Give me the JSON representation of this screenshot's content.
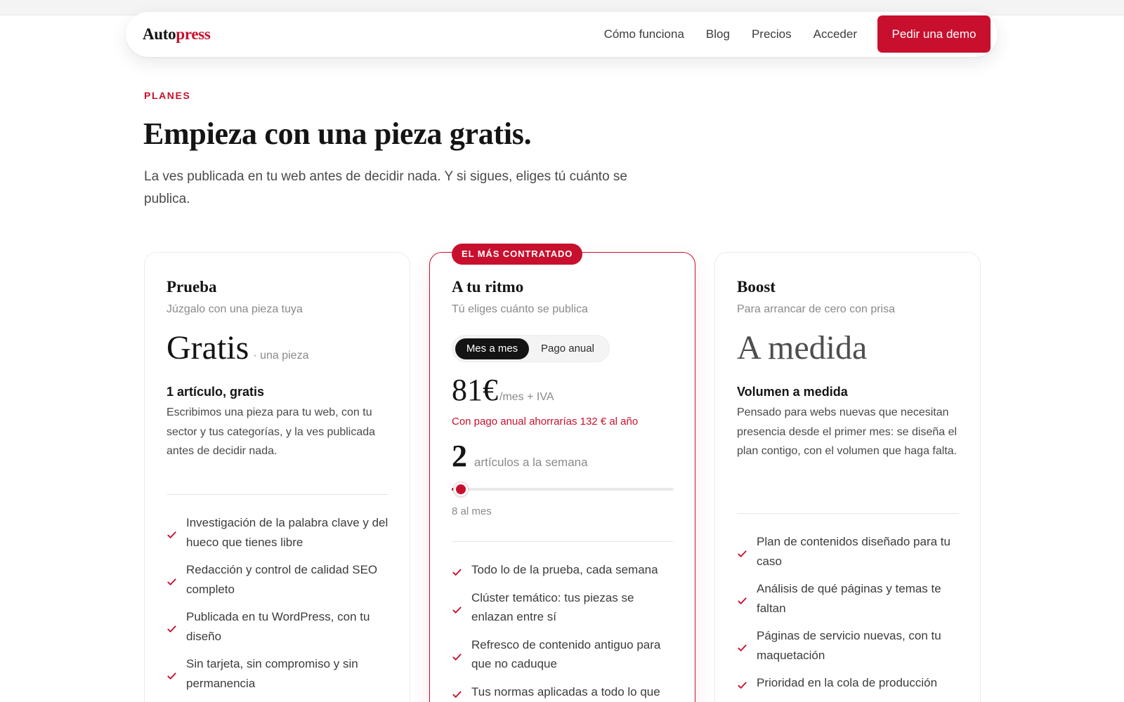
{
  "nav": {
    "logo_main": "Auto",
    "logo_accent": "press",
    "links": [
      "Cómo funciona",
      "Blog",
      "Precios",
      "Acceder"
    ],
    "cta": "Pedir una demo"
  },
  "hero": {
    "eyebrow": "PLANES",
    "title": "Empieza con una pieza gratis.",
    "subtitle": "La ves publicada en tu web antes de decidir nada. Y si sigues, eliges tú cuánto se publica."
  },
  "plans": [
    {
      "name": "Prueba",
      "tagline": "Júzgalo con una pieza tuya",
      "price": "Gratis",
      "price_suffix": "· una pieza",
      "feature_title": "1 artículo, gratis",
      "feature_desc": "Escribimos una pieza para tu web, con tu sector y tus categorías, y la ves publicada antes de decidir nada.",
      "features": [
        "Investigación de la palabra clave y del hueco que tienes libre",
        "Redacción y control de calidad SEO completo",
        "Publicada en tu WordPress, con tu diseño",
        "Sin tarjeta, sin compromiso y sin permanencia"
      ]
    },
    {
      "badge": "EL MÁS CONTRATADO",
      "name": "A tu ritmo",
      "tagline": "Tú eliges cuánto se publica",
      "billing_options": [
        "Mes a mes",
        "Pago anual"
      ],
      "billing_selected": "Mes a mes",
      "price": "81€",
      "price_suffix": "/mes + IVA",
      "saving_note": "Con pago anual ahorrarías 132 € al año",
      "quantity": "2",
      "quantity_label": "artículos a la semana",
      "slider_fraction": 0.04,
      "slider_caption": "8 al mes",
      "features": [
        "Todo lo de la prueba, cada semana",
        "Clúster temático: tus piezas se enlazan entre sí",
        "Refresco de contenido antiguo para que no caduque",
        "Tus normas aplicadas a todo lo que"
      ]
    },
    {
      "name": "Boost",
      "tagline": "Para arrancar de cero con prisa",
      "price": "A medida",
      "feature_title": "Volumen a medida",
      "feature_desc": "Pensado para webs nuevas que necesitan presencia desde el primer mes: se diseña el plan contigo, con el volumen que haga falta.",
      "features": [
        "Plan de contenidos diseñado para tu caso",
        "Análisis de qué páginas y temas te faltan",
        "Páginas de servicio nuevas, con tu maquetación",
        "Prioridad en la cola de producción"
      ]
    }
  ],
  "colors": {
    "accent": "#c8102e",
    "text_dark": "#141414",
    "text_muted": "#8a8a8a"
  },
  "icons": {
    "feature_bullet": "check-icon"
  }
}
